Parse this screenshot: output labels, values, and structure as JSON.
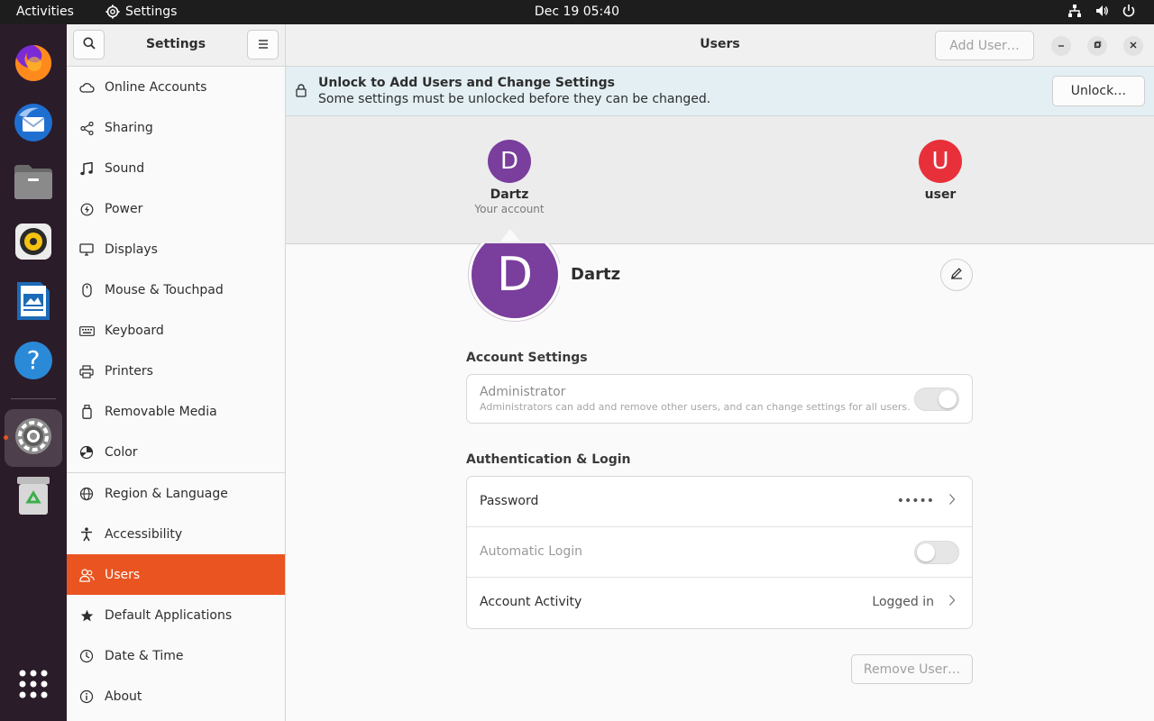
{
  "topbar": {
    "activities": "Activities",
    "app_name": "Settings",
    "clock": "Dec 19  05:40"
  },
  "dock": {
    "items": [
      {
        "name": "firefox-icon"
      },
      {
        "name": "thunderbird-icon"
      },
      {
        "name": "files-icon"
      },
      {
        "name": "rhythmbox-icon"
      },
      {
        "name": "libreoffice-writer-icon"
      },
      {
        "name": "help-icon"
      },
      {
        "name": "settings-icon",
        "active": true
      },
      {
        "name": "trash-icon"
      },
      {
        "name": "show-apps-icon"
      }
    ]
  },
  "sidebar": {
    "title": "Settings",
    "items": [
      {
        "label": "Online Accounts",
        "icon": "cloud-icon"
      },
      {
        "label": "Sharing",
        "icon": "share-icon"
      },
      {
        "label": "Sound",
        "icon": "music-note-icon"
      },
      {
        "label": "Power",
        "icon": "power-icon"
      },
      {
        "label": "Displays",
        "icon": "display-icon"
      },
      {
        "label": "Mouse & Touchpad",
        "icon": "mouse-icon"
      },
      {
        "label": "Keyboard",
        "icon": "keyboard-icon"
      },
      {
        "label": "Printers",
        "icon": "printer-icon"
      },
      {
        "label": "Removable Media",
        "icon": "usb-drive-icon"
      },
      {
        "label": "Color",
        "icon": "color-icon"
      },
      {
        "label": "Region & Language",
        "icon": "globe-icon"
      },
      {
        "label": "Accessibility",
        "icon": "accessibility-icon"
      },
      {
        "label": "Users",
        "icon": "users-icon",
        "active": true
      },
      {
        "label": "Default Applications",
        "icon": "star-icon"
      },
      {
        "label": "Date & Time",
        "icon": "clock-icon"
      },
      {
        "label": "About",
        "icon": "info-icon"
      }
    ]
  },
  "main": {
    "title": "Users",
    "add_user": "Add User…",
    "infobar": {
      "title": "Unlock to Add Users and Change Settings",
      "subtitle": "Some settings must be unlocked before they can be changed.",
      "unlock": "Unlock…"
    },
    "carousel": [
      {
        "initial": "D",
        "name": "Dartz",
        "sub": "Your account",
        "color": "#7a3e9d"
      },
      {
        "initial": "U",
        "name": "user",
        "sub": "",
        "color": "#e8303a"
      }
    ],
    "profile": {
      "initial": "D",
      "name": "Dartz"
    },
    "account_settings": {
      "title": "Account Settings",
      "admin_label": "Administrator",
      "admin_desc": "Administrators can add and remove other users, and can change settings for all users.",
      "admin_on": true
    },
    "auth": {
      "title": "Authentication & Login",
      "password_label": "Password",
      "password_value": "•••••",
      "autologin_label": "Automatic Login",
      "autologin_on": false,
      "activity_label": "Account Activity",
      "activity_value": "Logged in"
    },
    "remove_user": "Remove User…"
  },
  "colors": {
    "accent": "#e95420",
    "dock_bg": "#2b1c2a",
    "topbar_bg": "#1d1d1d"
  }
}
